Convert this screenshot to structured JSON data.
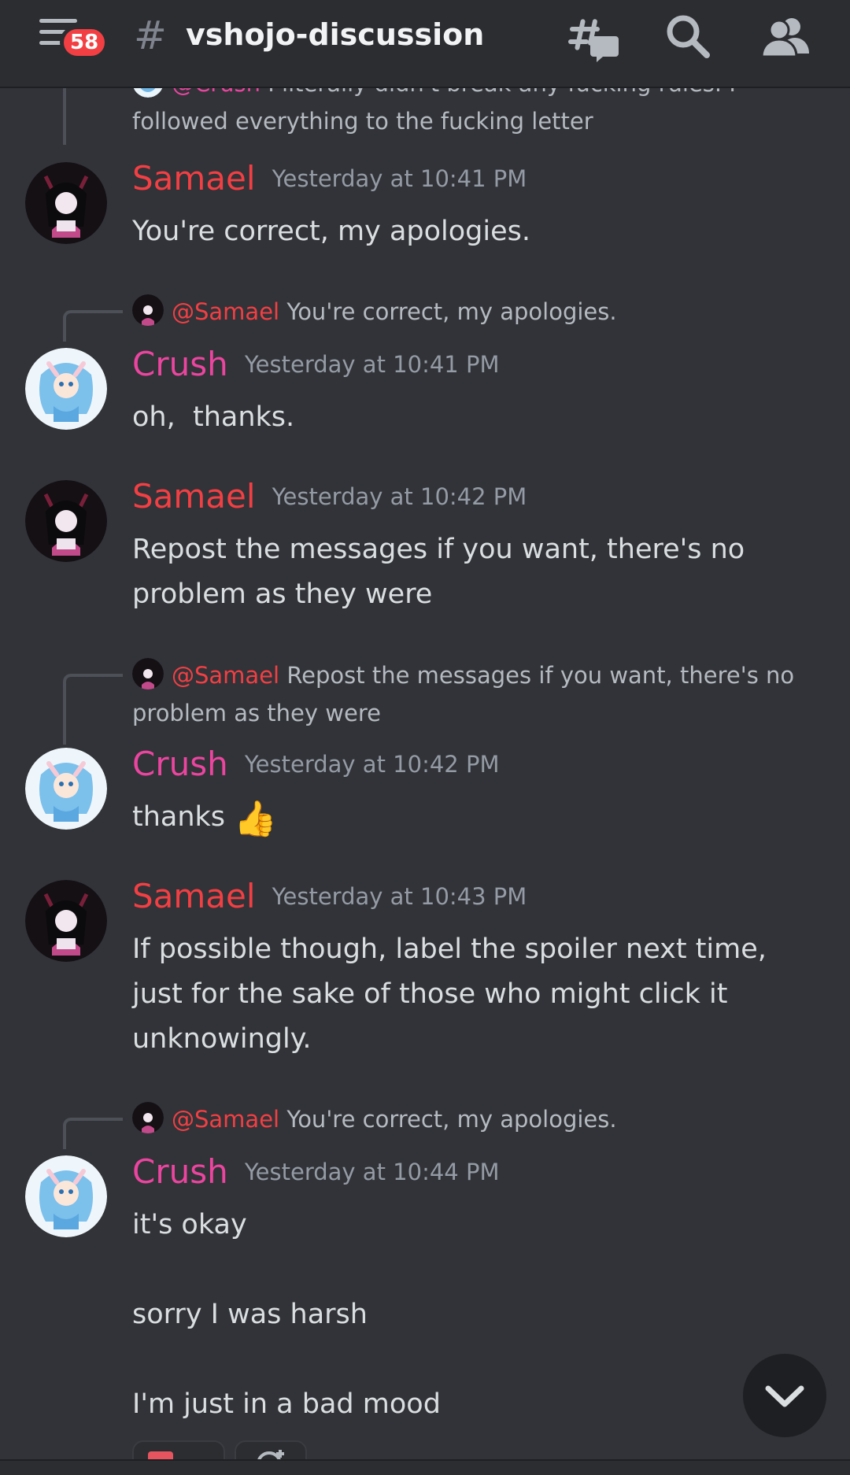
{
  "header": {
    "unread_badge": "58",
    "hash_symbol": "#",
    "channel_name": "vshojo-discussion",
    "icons": [
      "menu-icon",
      "threads-icon",
      "search-icon",
      "members-icon"
    ]
  },
  "colors": {
    "samael": "#f23f43",
    "crush": "#eb459f",
    "background": "#313338",
    "header": "#2b2d31",
    "timestamp": "#949ba4"
  },
  "messages": [
    {
      "reply": {
        "author": "@Crush",
        "text": "I literally didn't break any fucking rules. I followed everything to the fucking letter"
      }
    },
    {
      "author": "Samael",
      "timestamp": "Yesterday at 10:41 PM",
      "lines": [
        "You're correct, my apologies."
      ]
    },
    {
      "reply": {
        "author": "@Samael",
        "text": "You're correct, my apologies."
      },
      "author": "Crush",
      "timestamp": "Yesterday at 10:41 PM",
      "lines": [
        "oh,  thanks."
      ]
    },
    {
      "author": "Samael",
      "timestamp": "Yesterday at 10:42 PM",
      "lines": [
        "Repost the messages if you want, there's no problem as they were"
      ]
    },
    {
      "reply": {
        "author": "@Samael",
        "text": "Repost the messages if you want, there's no problem as they were"
      },
      "author": "Crush",
      "timestamp": "Yesterday at 10:42 PM",
      "lines": [
        "thanks"
      ],
      "emoji": "👍"
    },
    {
      "author": "Samael",
      "timestamp": "Yesterday at 10:43 PM",
      "lines": [
        "If possible though, label the spoiler next time, just for the sake of those who might click it unknowingly."
      ]
    },
    {
      "reply": {
        "author": "@Samael",
        "text": "You're correct, my apologies."
      },
      "author": "Crush",
      "timestamp": "Yesterday at 10:44 PM",
      "lines": [
        "it's okay",
        "",
        "sorry I was harsh",
        "",
        "I'm just in a bad mood"
      ]
    }
  ]
}
